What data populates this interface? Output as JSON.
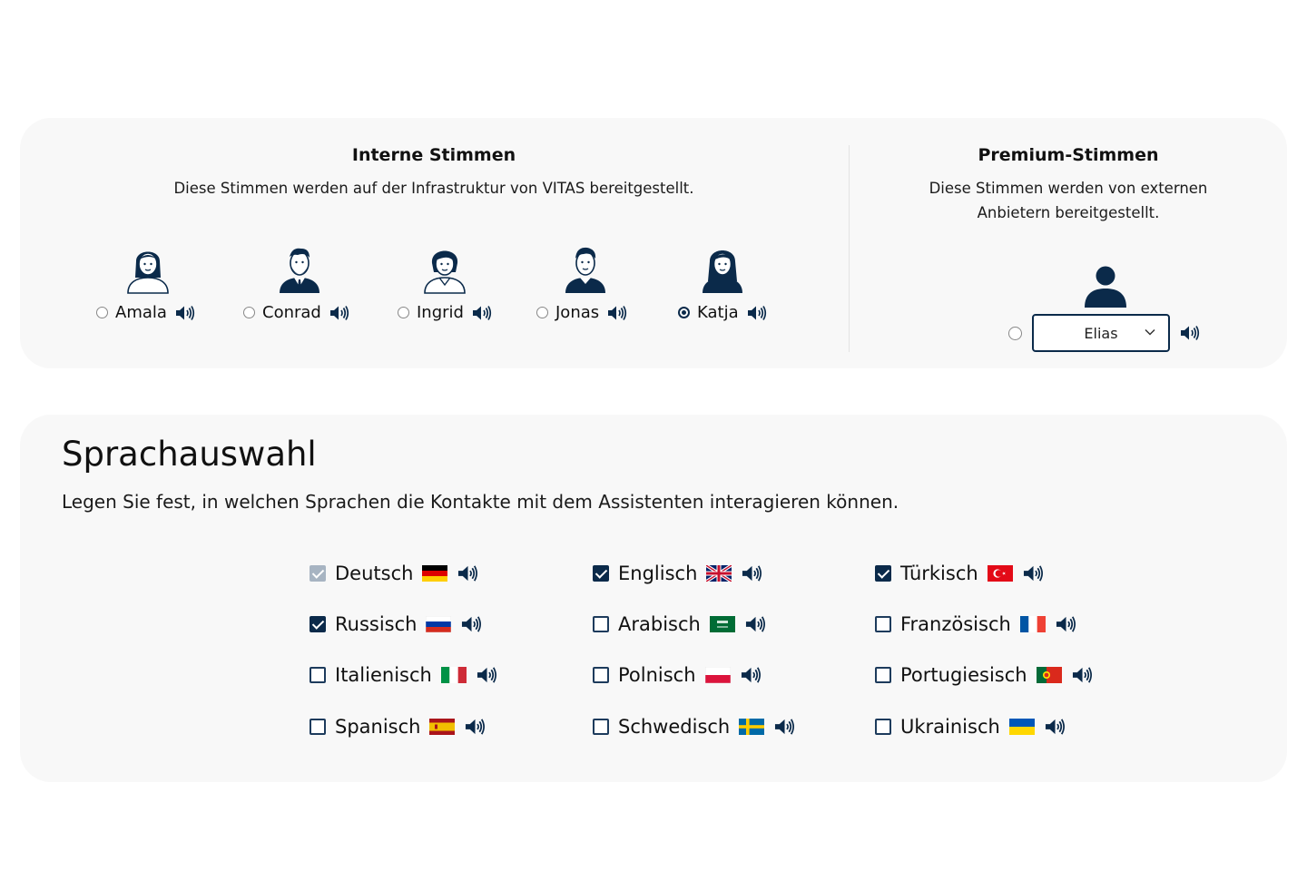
{
  "internal": {
    "title": "Interne Stimmen",
    "subtitle": "Diese Stimmen werden auf der Infrastruktur von VITAS bereitgestellt.",
    "voices": [
      {
        "name": "Amala",
        "selected": false
      },
      {
        "name": "Conrad",
        "selected": false
      },
      {
        "name": "Ingrid",
        "selected": false
      },
      {
        "name": "Jonas",
        "selected": false
      },
      {
        "name": "Katja",
        "selected": true
      }
    ]
  },
  "premium": {
    "title": "Premium-Stimmen",
    "subtitle": "Diese Stimmen werden von externen Anbietern bereitgestellt.",
    "selected_voice": "Elias",
    "radio_selected": false
  },
  "languages": {
    "title": "Sprachauswahl",
    "description": "Legen Sie fest, in welchen Sprachen die Kontakte mit dem Assistenten interagieren können.",
    "items": [
      {
        "label": "Deutsch",
        "checked": true,
        "disabled": true,
        "flag": "de"
      },
      {
        "label": "Englisch",
        "checked": true,
        "disabled": false,
        "flag": "gb"
      },
      {
        "label": "Türkisch",
        "checked": true,
        "disabled": false,
        "flag": "tr"
      },
      {
        "label": "Russisch",
        "checked": true,
        "disabled": false,
        "flag": "ru"
      },
      {
        "label": "Arabisch",
        "checked": false,
        "disabled": false,
        "flag": "sa"
      },
      {
        "label": "Französisch",
        "checked": false,
        "disabled": false,
        "flag": "fr"
      },
      {
        "label": "Italienisch",
        "checked": false,
        "disabled": false,
        "flag": "it"
      },
      {
        "label": "Polnisch",
        "checked": false,
        "disabled": false,
        "flag": "pl"
      },
      {
        "label": "Portugiesisch",
        "checked": false,
        "disabled": false,
        "flag": "pt"
      },
      {
        "label": "Spanisch",
        "checked": false,
        "disabled": false,
        "flag": "es"
      },
      {
        "label": "Schwedisch",
        "checked": false,
        "disabled": false,
        "flag": "se"
      },
      {
        "label": "Ukrainisch",
        "checked": false,
        "disabled": false,
        "flag": "ua"
      }
    ]
  },
  "colors": {
    "primary": "#0b2a4a",
    "card_background": "#f8f8f8",
    "disabled_check": "#a7b4c2"
  },
  "icons": {
    "speaker": "speaker-icon",
    "avatar": "person-avatar-icon",
    "chevron": "chevron-down-icon"
  }
}
